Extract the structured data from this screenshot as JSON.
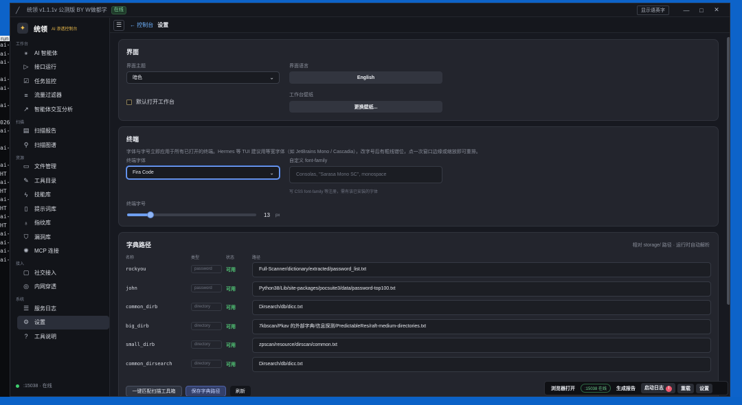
{
  "window": {
    "title": "统领 v1.1.1v 公测版 BY W做都学",
    "status_badge": "在线",
    "top_button": "显示语英字",
    "controls": [
      "—",
      "□",
      "✕"
    ]
  },
  "brand": {
    "name": "统领",
    "subtitle": "AI 渗透控制台"
  },
  "sidebar": {
    "sections": [
      {
        "title": "工作台",
        "items": [
          {
            "icon": "ai-agent-icon",
            "glyph": "⚹",
            "label": "AI 智能体"
          },
          {
            "icon": "play-icon",
            "glyph": "▷",
            "label": "接口运行"
          },
          {
            "icon": "checklist-icon",
            "glyph": "☑",
            "label": "任务监控"
          },
          {
            "icon": "filter-icon",
            "glyph": "≡",
            "label": "流量过滤器"
          },
          {
            "icon": "chart-icon",
            "glyph": "↗",
            "label": "智能体交互分析"
          }
        ]
      },
      {
        "title": "扫描",
        "items": [
          {
            "icon": "report-icon",
            "glyph": "▤",
            "label": "扫描报告"
          },
          {
            "icon": "graph-icon",
            "glyph": "⚲",
            "label": "扫描图谱"
          }
        ]
      },
      {
        "title": "资源",
        "items": [
          {
            "icon": "folder-icon",
            "glyph": "▭",
            "label": "文件管理"
          },
          {
            "icon": "wrench-icon",
            "glyph": "✎",
            "label": "工具目录"
          },
          {
            "icon": "lightning-icon",
            "glyph": "ϟ",
            "label": "技能库"
          },
          {
            "icon": "book-icon",
            "glyph": "▯",
            "label": "提示词库"
          },
          {
            "icon": "lightbulb-icon",
            "glyph": "♁",
            "label": "指纹库"
          },
          {
            "icon": "shield-icon",
            "glyph": "⛉",
            "label": "漏洞库"
          },
          {
            "icon": "mcp-icon",
            "glyph": "✺",
            "label": "MCP 连接"
          }
        ]
      },
      {
        "title": "接入",
        "items": [
          {
            "icon": "chat-icon",
            "glyph": "▢",
            "label": "社交接入"
          },
          {
            "icon": "globe-icon",
            "glyph": "◎",
            "label": "内网穿透"
          }
        ]
      },
      {
        "title": "系统",
        "items": [
          {
            "icon": "log-icon",
            "glyph": "☰",
            "label": "服务日志"
          },
          {
            "icon": "gear-icon",
            "glyph": "⚙",
            "label": "设置",
            "active": true
          },
          {
            "icon": "help-icon",
            "glyph": "?",
            "label": "工具说明"
          }
        ]
      }
    ],
    "footer_status": ":15038 · 在线"
  },
  "topbar": {
    "menu_glyph": "☰",
    "back": "← 控制台",
    "current": "设置"
  },
  "interface_card": {
    "title": "界面",
    "theme_label": "界面主题",
    "theme_value": "暗色",
    "lang_label": "界面语言",
    "lang_button": "English",
    "checkbox_label": "默认打开工作台",
    "wallpaper_label": "工作台壁纸",
    "wallpaper_button": "更换壁纸..."
  },
  "terminal_card": {
    "title": "终端",
    "description": "字体与字号立即应用于所有已打开的终端。Hermes 等 TUI 建议用等宽字体（如 JetBrains Mono / Cascadia），改字号后有框线错位，点一次窗口边缘或缩放即可重排。",
    "font_label": "终端字体",
    "font_value": "Fira Code",
    "custom_label": "自定义 font-family",
    "custom_placeholder": "Consolas, \"Sarasa Mono SC\", monospace",
    "custom_hint": "写 CSS font-family 等注册，需有该已安装的字体",
    "size_label": "终端字号",
    "size_value": "13",
    "size_unit": "px",
    "size_fraction": 0.18
  },
  "dict_card": {
    "title": "字典路径",
    "hint": "相对 storage/ 路径 · 运行时自动解析",
    "columns": [
      "名称",
      "类型",
      "状态",
      "路径"
    ],
    "rows": [
      {
        "name": "rockyou",
        "type": "password",
        "status": "可用",
        "path": "Full-Scanner/dictionary/extracted/password_list.txt"
      },
      {
        "name": "john",
        "type": "password",
        "status": "可用",
        "path": "Python38/Lib/site-packages/pocsuite3/data/password-top100.txt"
      },
      {
        "name": "common_dirb",
        "type": "directory",
        "status": "可用",
        "path": "Dirsearch/db/dicc.txt"
      },
      {
        "name": "big_dirb",
        "type": "directory",
        "status": "可用",
        "path": "7kbscan/Pkav 的外部字典/信息探测/PredictableRes/raft-medium-directories.txt"
      },
      {
        "name": "small_dirb",
        "type": "directory",
        "status": "可用",
        "path": "zpscan/resource/dirscan/common.txt"
      },
      {
        "name": "common_dirsearch",
        "type": "directory",
        "status": "可用",
        "path": "Dirsearch/db/dicc.txt"
      }
    ],
    "buttons": {
      "match": "一键匹配扫描工具箱",
      "save": "保存字典路径",
      "refresh": "刷新"
    }
  },
  "dock": {
    "browser": "浏览器打开",
    "port": ":15038 在线",
    "report": "生成报告",
    "startup_log": "启动日志",
    "startup_badge": "!",
    "restart": "重载",
    "settings": "设置"
  },
  "colors": {
    "accent": "#6fb3ff",
    "ok": "#54d17a",
    "bg": "#171920",
    "card": "#23252d"
  }
}
